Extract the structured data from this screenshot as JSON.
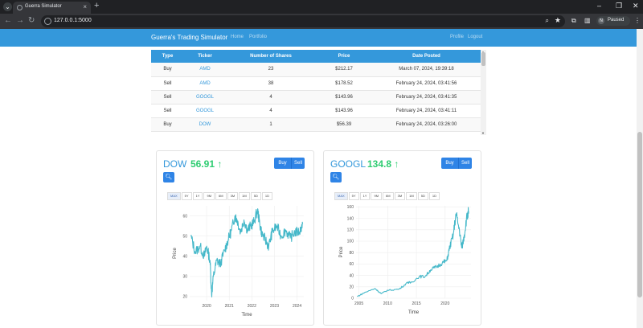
{
  "browser": {
    "tab_title": "Guerra Simulator",
    "url": "127.0.0.1:5000",
    "profile_label": "Paused",
    "profile_initial": "N"
  },
  "nav": {
    "brand": "Guerra's Trading Simulator",
    "home": "Home",
    "portfolio": "Portfolio",
    "profile": "Profile",
    "logout": "Logout"
  },
  "trades": {
    "headers": [
      "Type",
      "Ticker",
      "Number of Shares",
      "Price",
      "Date Posted"
    ],
    "rows": [
      [
        "Buy",
        "AMD",
        "23",
        "$212.17",
        "March 07, 2024, 19:39:18"
      ],
      [
        "Sell",
        "AMD",
        "38",
        "$178.52",
        "February 24, 2024, 03:41:56"
      ],
      [
        "Sell",
        "GOOGL",
        "4",
        "$143.96",
        "February 24, 2024, 03:41:35"
      ],
      [
        "Sell",
        "GOOGL",
        "4",
        "$143.96",
        "February 24, 2024, 03:41:11"
      ],
      [
        "Buy",
        "DOW",
        "1",
        "$56.39",
        "February 24, 2024, 03:26:00"
      ]
    ]
  },
  "cards": [
    {
      "ticker": "DOW",
      "price": "56.91",
      "buy_label": "Buy",
      "sell_label": "Sell",
      "ranges": [
        "MAX",
        "5Y",
        "1Y",
        "9M",
        "6M",
        "3M",
        "1M",
        "5D",
        "1D"
      ]
    },
    {
      "ticker": "GOOGL",
      "price": "134.8",
      "buy_label": "Buy",
      "sell_label": "Sell",
      "ranges": [
        "MAX",
        "5Y",
        "1Y",
        "9M",
        "6M",
        "3M",
        "1M",
        "5D",
        "1D"
      ]
    }
  ],
  "colors": {
    "accent": "#3498db",
    "up": "#2ecc71",
    "line": "#45b8c9"
  },
  "chart_data": [
    {
      "type": "line",
      "xlabel": "Time",
      "ylabel": "Price",
      "xlim": [
        2019.25,
        2024.3
      ],
      "ylim": [
        18,
        65
      ],
      "xticks": [
        "2020",
        "2021",
        "2022",
        "2023",
        "2024"
      ],
      "yticks": [
        "20",
        "30",
        "40",
        "50",
        "60"
      ],
      "x": [
        2019.3,
        2019.5,
        2019.7,
        2019.9,
        2020.0,
        2020.15,
        2020.22,
        2020.3,
        2020.45,
        2020.6,
        2020.8,
        2020.95,
        2021.1,
        2021.25,
        2021.35,
        2021.5,
        2021.65,
        2021.8,
        2021.95,
        2022.1,
        2022.25,
        2022.35,
        2022.45,
        2022.6,
        2022.75,
        2022.9,
        2023.1,
        2023.3,
        2023.5,
        2023.7,
        2023.9,
        2024.1,
        2024.25
      ],
      "y": [
        50,
        42,
        45,
        40,
        45,
        38,
        21,
        30,
        38,
        36,
        43,
        48,
        53,
        60,
        58,
        52,
        58,
        53,
        55,
        57,
        63,
        56,
        51,
        48,
        45,
        52,
        55,
        50,
        53,
        49,
        52,
        52,
        56
      ]
    },
    {
      "type": "line",
      "xlabel": "Time",
      "ylabel": "Price",
      "xlim": [
        2004.5,
        2024.5
      ],
      "ylim": [
        0,
        162
      ],
      "xticks": [
        "2005",
        "2010",
        "2015",
        "2020"
      ],
      "yticks": [
        "0",
        "20",
        "40",
        "60",
        "80",
        "100",
        "120",
        "140",
        "160"
      ],
      "x": [
        2004.7,
        2006,
        2007.8,
        2008.9,
        2010,
        2012,
        2013.5,
        2014,
        2015.5,
        2016.5,
        2017.5,
        2018.5,
        2019.5,
        2020.3,
        2020.8,
        2021.4,
        2021.9,
        2022.5,
        2022.9,
        2023.3,
        2023.7,
        2024.1
      ],
      "y": [
        3,
        10,
        17,
        8,
        14,
        16,
        28,
        27,
        38,
        38,
        50,
        55,
        62,
        66,
        90,
        110,
        148,
        118,
        88,
        108,
        138,
        152
      ]
    }
  ]
}
